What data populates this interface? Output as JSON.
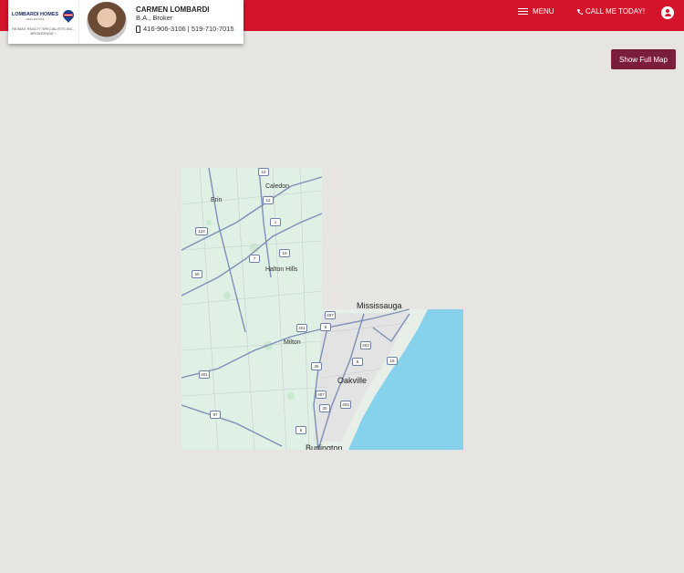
{
  "header": {
    "brand": {
      "name": "LOMBARDI HOMES",
      "sub": "REAL ESTATE",
      "broker": "RE/MAX REALTY SPECIALISTS INC., BROKERAGE *"
    },
    "agent": {
      "name": "CARMEN LOMBARDI",
      "title": "B.A., Broker",
      "phones": "416-906-3106 | 519-710-7015"
    },
    "menu_label": "MENU",
    "call_label": "CALL ME TODAY!"
  },
  "map": {
    "show_full_map_label": "Show Full Map",
    "places": {
      "caledon": "Caledon",
      "erin": "Erin",
      "halton_hills": "Halton Hills",
      "milton": "Milton",
      "oakville": "Oakville",
      "mississauga": "Mississauga",
      "burlington": "Burlington"
    },
    "routes": [
      "10",
      "12",
      "1",
      "124",
      "19",
      "7",
      "50",
      "401",
      "5",
      "407",
      "403",
      "25",
      "19",
      "5",
      "407",
      "401",
      "20",
      "97",
      "403",
      "5"
    ]
  },
  "colors": {
    "header": "#d3142b",
    "button": "#7b1e3b",
    "land": "#dff0e4",
    "water": "#86d2ec",
    "background": "#e6e5e2"
  }
}
